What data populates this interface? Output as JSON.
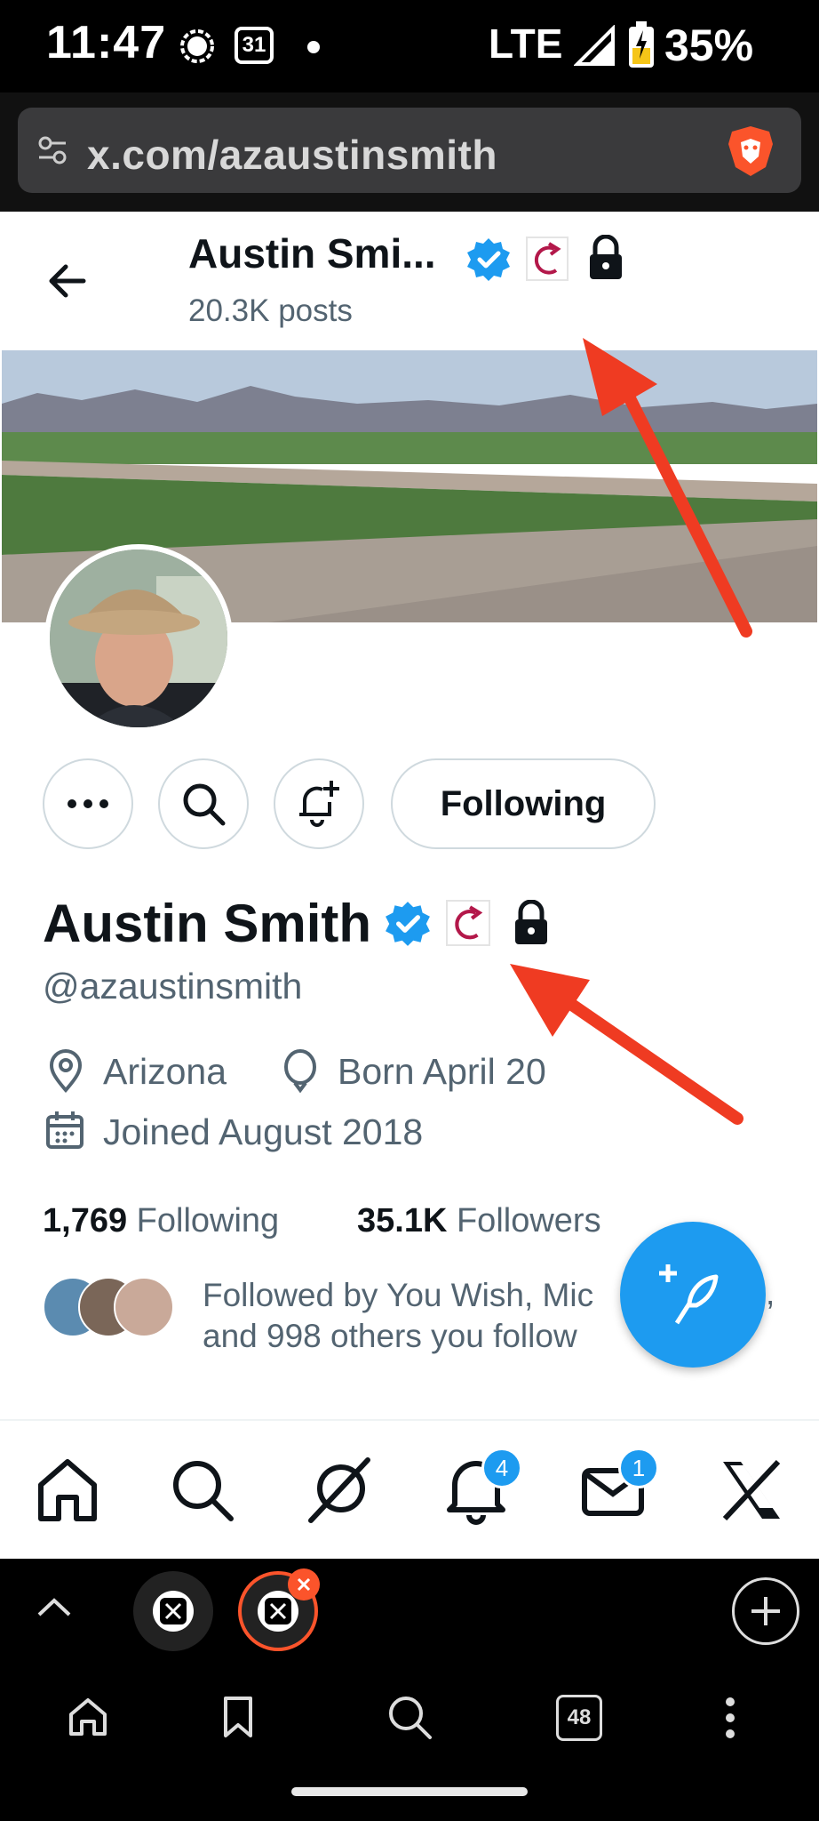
{
  "status": {
    "time": "11:47",
    "calendar_day": "31",
    "network": "LTE",
    "battery": "35%"
  },
  "browser": {
    "url": "x.com/azaustinsmith",
    "tabs_count": "48"
  },
  "header": {
    "name": "Austin Smi...",
    "posts": "20.3K posts"
  },
  "profile": {
    "name": "Austin Smith",
    "handle": "@azaustinsmith",
    "location": "Arizona",
    "birthday": "Born April 20",
    "joined": "Joined August 2018",
    "following_count": "1,769",
    "following_label": "Following",
    "followers_count": "35.1K",
    "followers_label": "Followers",
    "followed_by_line1": "Followed by You Wish, Mic",
    "followed_by_line1_end": ",",
    "followed_by_line2": "and 998 others you follow",
    "follow_button": "Following"
  },
  "nav": {
    "notifications_badge": "4",
    "messages_badge": "1"
  },
  "colors": {
    "accent": "#1d9bf0",
    "arrow": "#ef3b22",
    "brave": "#fb542b"
  }
}
